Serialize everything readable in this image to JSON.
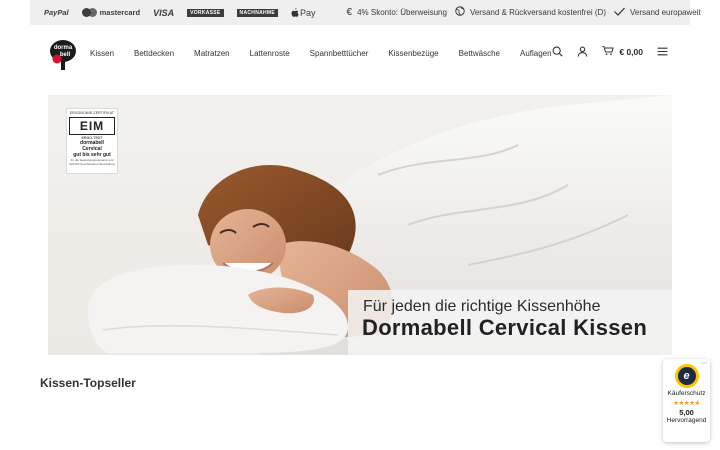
{
  "topbar": {
    "payments": [
      {
        "label": "PayPal",
        "icon": "paypal-icon"
      },
      {
        "label": "mastercard",
        "icon": "mastercard-icon"
      },
      {
        "label": "VISA",
        "icon": "visa-icon"
      },
      {
        "label": "VORKASSE",
        "icon": "vorkasse-icon"
      },
      {
        "label": "NACHNAHME",
        "icon": "nachnahme-icon"
      },
      {
        "label": "Pay",
        "icon": "apple-pay-icon"
      }
    ],
    "usps": [
      {
        "label": "4% Skonto: Überweisung",
        "icon": "euro-icon"
      },
      {
        "label": "Versand & Rückversand kostenfrei (D)",
        "icon": "globe-icon"
      },
      {
        "label": "Versand europaweit",
        "icon": "check-icon"
      }
    ]
  },
  "header": {
    "logo_text_top": "dorma",
    "logo_text_bottom": "bell",
    "nav": [
      "Kissen",
      "Bettdecken",
      "Matratzen",
      "Lattenroste",
      "Spannbetttücher",
      "Kissenbezüge",
      "Bettwäsche",
      "Auflagen"
    ],
    "cart_total": "€ 0,00"
  },
  "banner": {
    "seal": {
      "top_text": "ERGONOMIE-ZERTIFIKAT",
      "logo": "EIM",
      "logo_sub": "ERGO-TEST",
      "line1": "dormabell",
      "line2": "Cervical",
      "line3": "gut bis sehr gut",
      "small": "für die bewertungsrelevante und fachlich beschriebene Beurteilung"
    },
    "subtitle": "Für jeden die richtige Kissenhöhe",
    "title": "Dormabell Cervical Kissen"
  },
  "section": {
    "title": "Kissen-Topseller"
  },
  "trust_badge": {
    "label": "Käuferschutz",
    "stars": "★★★★★",
    "score": "5,00",
    "rating": "Hervorragend",
    "menu": "⋯"
  },
  "colors": {
    "topbar_bg": "#efefef",
    "star": "#f19a18",
    "trust_yellow": "#fdc400",
    "trust_navy": "#1c2b45"
  }
}
